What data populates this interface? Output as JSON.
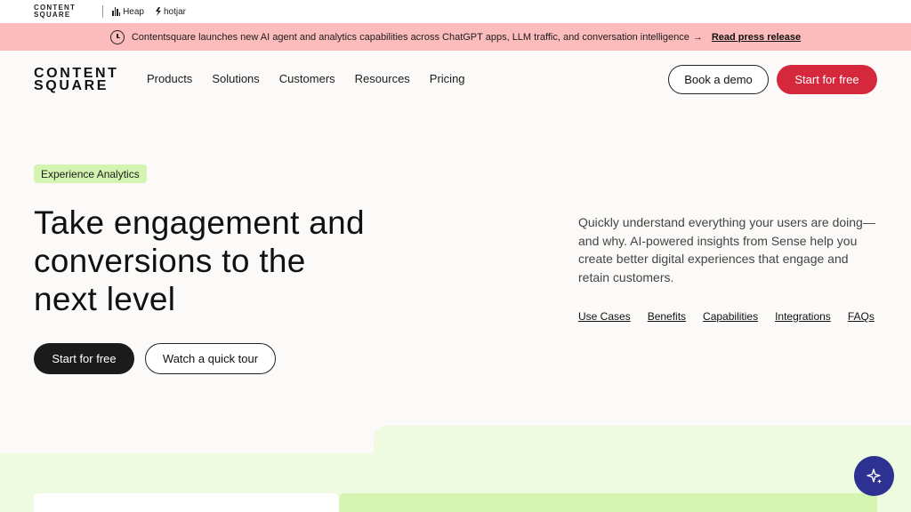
{
  "brandbar": {
    "cs_line1": "CONTENT",
    "cs_line2": "SQUARE",
    "heap": "Heap",
    "hotjar": "hotjar"
  },
  "announcement": {
    "text": "Contentsquare launches new AI agent and analytics capabilities across ChatGPT apps, LLM traffic, and conversation intelligence",
    "arrow": "→",
    "link": "Read press release"
  },
  "nav": {
    "logo_line1": "CONTENT",
    "logo_line2": "SQUARE",
    "items": [
      "Products",
      "Solutions",
      "Customers",
      "Resources",
      "Pricing"
    ],
    "book_demo": "Book a demo",
    "start_free": "Start for free"
  },
  "hero": {
    "tag": "Experience Analytics",
    "headline_line1": "Take engagement and",
    "headline_line2": "conversions to the",
    "headline_line3": "next level",
    "cta_primary": "Start for free",
    "cta_secondary": "Watch a quick tour",
    "description": "Quickly understand everything your users are doing—and why. AI-powered insights from Sense help you create better digital experiences that engage and retain customers.",
    "anchors": [
      "Use Cases",
      "Benefits",
      "Capabilities",
      "Integrations",
      "FAQs"
    ]
  },
  "colors": {
    "accent_red": "#d6283c",
    "announce_bg": "#fcbcbc",
    "tag_green": "#d3f5b1",
    "ai_button": "#2d3191"
  }
}
